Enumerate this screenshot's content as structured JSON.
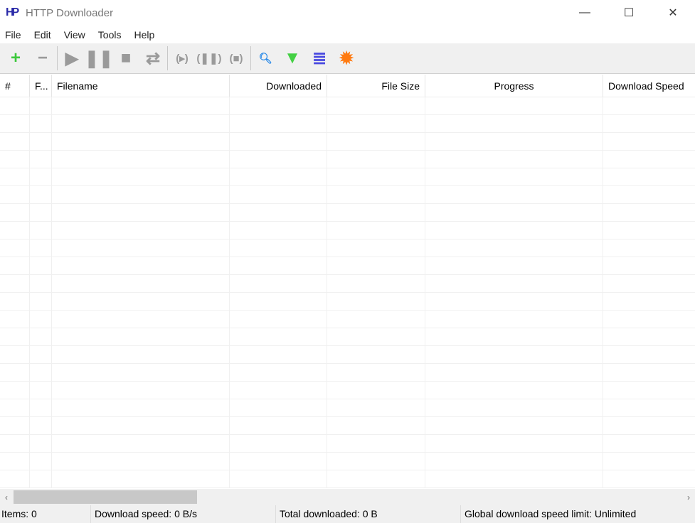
{
  "window": {
    "title": "HTTP Downloader",
    "logo": "HD"
  },
  "menu": [
    "File",
    "Edit",
    "View",
    "Tools",
    "Help"
  ],
  "toolbar": [
    {
      "name": "add-icon",
      "glyph": "+",
      "color": "#3cc83c"
    },
    {
      "name": "remove-icon",
      "glyph": "−",
      "color": "#9a9a9a"
    },
    {
      "sep": true
    },
    {
      "name": "start-icon",
      "glyph": "▶",
      "color": "#9a9a9a"
    },
    {
      "name": "pause-icon",
      "glyph": "❚❚",
      "color": "#9a9a9a"
    },
    {
      "name": "stop-icon",
      "glyph": "■",
      "color": "#9a9a9a"
    },
    {
      "name": "restart-icon",
      "glyph": "⇄",
      "color": "#9a9a9a"
    },
    {
      "sep": true
    },
    {
      "name": "start-all-icon",
      "glyph": "(▸)",
      "color": "#9a9a9a"
    },
    {
      "name": "pause-all-icon",
      "glyph": "(❚❚)",
      "color": "#9a9a9a"
    },
    {
      "name": "stop-all-icon",
      "glyph": "(■)",
      "color": "#9a9a9a"
    },
    {
      "sep": true
    },
    {
      "name": "search-icon",
      "glyph": "🔍︎",
      "color": "#2a8ae8"
    },
    {
      "name": "filter-icon",
      "glyph": "▼",
      "color": "#44d044"
    },
    {
      "name": "list-icon",
      "glyph": "≣",
      "color": "#4848e0"
    },
    {
      "name": "options-icon",
      "glyph": "✹",
      "color": "#ff7a10"
    }
  ],
  "columns": [
    "#",
    "F...",
    "Filename",
    "Downloaded",
    "File Size",
    "Progress",
    "Download Speed"
  ],
  "status": {
    "items": "Items: 0",
    "speed": "Download speed: 0 B/s",
    "total": "Total downloaded: 0 B",
    "limit": "Global download speed limit: Unlimited"
  }
}
